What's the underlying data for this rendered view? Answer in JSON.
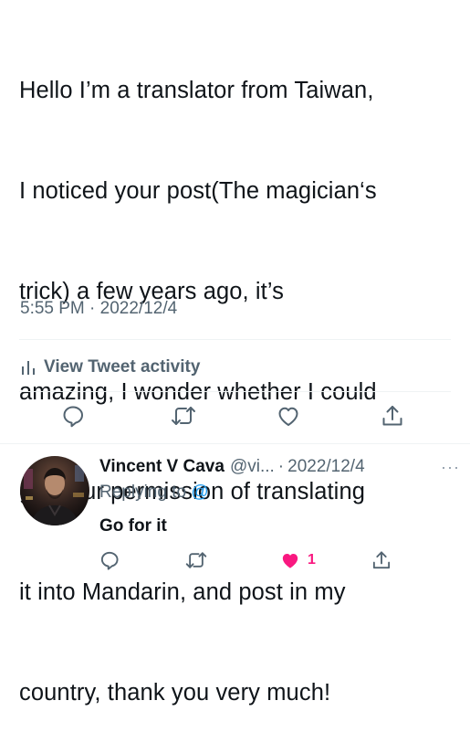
{
  "tweet": {
    "text_lines": [
      "Hello I’m a translator from Taiwan,",
      "I noticed your post(The magician‘s",
      "trick) a few years ago, it’s",
      "amazing, I wonder whether I could",
      "get your permission of translating",
      "it into Mandarin, and post in my",
      "country, thank you very much!"
    ],
    "timestamp": "5:55 PM · 2022/12/4",
    "activity_label": "View Tweet activity",
    "actions": [
      "reply-icon",
      "retweet-icon",
      "like-icon",
      "share-icon"
    ]
  },
  "reply": {
    "display_name": "Vincent V Cava",
    "handle": "@vi...",
    "separator": "·",
    "date": "2022/12/4",
    "more": "···",
    "replying_prefix": "Replying to",
    "replying_mention": "@",
    "text": "Go for it",
    "like_count": "1",
    "liked": true
  },
  "colors": {
    "text_primary": "#0f1419",
    "text_secondary": "#536471",
    "accent_blue": "#1d9bf0",
    "like_pink": "#f91880",
    "divider": "#eff3f4"
  }
}
